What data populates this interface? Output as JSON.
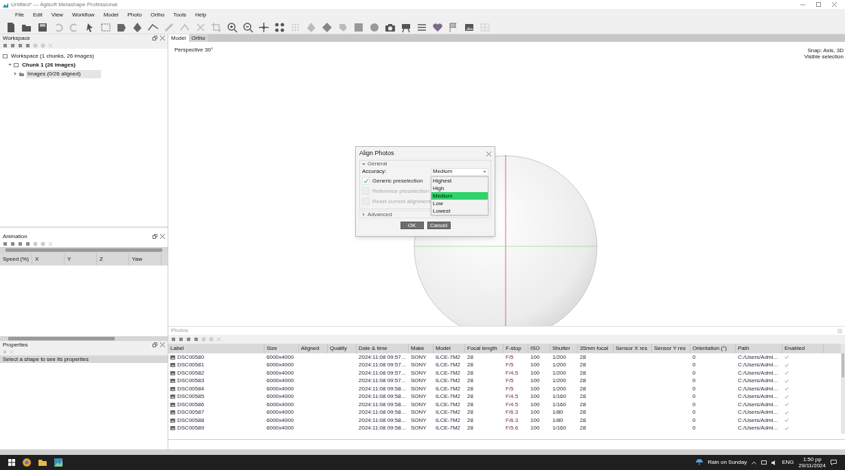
{
  "window": {
    "title": "Untitled* — Agisoft Metashape Professional"
  },
  "menu": [
    "File",
    "Edit",
    "View",
    "Workflow",
    "Model",
    "Photo",
    "Ortho",
    "Tools",
    "Help"
  ],
  "workspace": {
    "title": "Workspace",
    "tree": [
      {
        "label": "Workspace (1 chunks, 26 images)",
        "selected": false,
        "children": [
          {
            "label": "Chunk 1 (26 images)",
            "expanded": true,
            "selected": false,
            "children": [
              {
                "label": "Images (0/26 aligned)",
                "expanded": false,
                "selected": true
              }
            ]
          }
        ]
      }
    ]
  },
  "animation": {
    "title": "Animation",
    "columns": [
      "Speed (%)",
      "X",
      "Y",
      "Z",
      "Yaw"
    ]
  },
  "properties": {
    "title": "Properties",
    "hint": "Select a shape to see its properties"
  },
  "view_tabs": [
    {
      "label": "Model",
      "selected": true
    },
    {
      "label": "Ortho",
      "selected": false
    }
  ],
  "viewport": {
    "projection": "Perspective 30°",
    "snap": "Snap: Axis, 3D",
    "selection_mode": "Visible selection"
  },
  "dialog": {
    "title": "Align Photos",
    "section": "General",
    "accuracy_label": "Accuracy:",
    "accuracy_value": "Medium",
    "options": [
      {
        "label": "Highest",
        "selected": false
      },
      {
        "label": "High",
        "selected": false
      },
      {
        "label": "Medium",
        "selected": true
      },
      {
        "label": "Low",
        "selected": false
      },
      {
        "label": "Lowest",
        "selected": false
      }
    ],
    "checkboxes": [
      {
        "label": "Generic preselection",
        "checked": true,
        "disabled": false
      },
      {
        "label": "Reference preselection",
        "checked": false,
        "disabled": true
      },
      {
        "label": "Reset current alignment",
        "checked": false,
        "disabled": true
      }
    ],
    "advanced": "Advanced",
    "buttons": [
      "OK",
      "Cancel"
    ]
  },
  "photos": {
    "title": "Photos",
    "columns": [
      "Label",
      "Size",
      "Aligned",
      "Quality",
      "Date & time",
      "Make",
      "Model",
      "Focal length",
      "F-stop",
      "ISO",
      "Shutter",
      "35mm focal",
      "Sensor X res",
      "Sensor Y res",
      "Orientation (°)",
      "Path",
      "Enabled"
    ],
    "rows": [
      {
        "cells": [
          "DSC00580",
          "6000x4000",
          "",
          "",
          "2024:11:08 09:57...",
          "SONY",
          "ILCE-7M2",
          "28",
          "F/5",
          "100",
          "1/200",
          "28",
          "",
          "",
          "0",
          "C:/Users/Admi..."
        ],
        "enabled": true
      },
      {
        "cells": [
          "DSC00581",
          "6000x4000",
          "",
          "",
          "2024:11:08 09:57...",
          "SONY",
          "ILCE-7M2",
          "28",
          "F/5",
          "100",
          "1/200",
          "28",
          "",
          "",
          "0",
          "C:/Users/Admi..."
        ],
        "enabled": true
      },
      {
        "cells": [
          "DSC00582",
          "6000x4000",
          "",
          "",
          "2024:11:08 09:57...",
          "SONY",
          "ILCE-7M2",
          "28",
          "F/4.5",
          "100",
          "1/200",
          "28",
          "",
          "",
          "0",
          "C:/Users/Admi..."
        ],
        "enabled": true
      },
      {
        "cells": [
          "DSC00583",
          "6000x4000",
          "",
          "",
          "2024:11:08 09:57...",
          "SONY",
          "ILCE-7M2",
          "28",
          "F/5",
          "100",
          "1/200",
          "28",
          "",
          "",
          "0",
          "C:/Users/Admi..."
        ],
        "enabled": true
      },
      {
        "cells": [
          "DSC00584",
          "6000x4000",
          "",
          "",
          "2024:11:08 09:58...",
          "SONY",
          "ILCE-7M2",
          "28",
          "F/5",
          "100",
          "1/200",
          "28",
          "",
          "",
          "0",
          "C:/Users/Admi..."
        ],
        "enabled": true
      },
      {
        "cells": [
          "DSC00585",
          "6000x4000",
          "",
          "",
          "2024:11:08 09:58...",
          "SONY",
          "ILCE-7M2",
          "28",
          "F/4.5",
          "100",
          "1/160",
          "28",
          "",
          "",
          "0",
          "C:/Users/Admi..."
        ],
        "enabled": true
      },
      {
        "cells": [
          "DSC00586",
          "6000x4000",
          "",
          "",
          "2024:11:08 09:58...",
          "SONY",
          "ILCE-7M2",
          "28",
          "F/4.5",
          "100",
          "1/160",
          "28",
          "",
          "",
          "0",
          "C:/Users/Admi..."
        ],
        "enabled": true
      },
      {
        "cells": [
          "DSC00587",
          "6000x4000",
          "",
          "",
          "2024:11:08 09:58...",
          "SONY",
          "ILCE-7M2",
          "28",
          "F/6.3",
          "100",
          "1/80",
          "28",
          "",
          "",
          "0",
          "C:/Users/Admi..."
        ],
        "enabled": true
      },
      {
        "cells": [
          "DSC00588",
          "6000x4000",
          "",
          "",
          "2024:11:08 09:58...",
          "SONY",
          "ILCE-7M2",
          "28",
          "F/6.3",
          "100",
          "1/80",
          "28",
          "",
          "",
          "0",
          "C:/Users/Admi..."
        ],
        "enabled": true
      },
      {
        "cells": [
          "DSC00589",
          "6000x4000",
          "",
          "",
          "2024:11:08 09:58...",
          "SONY",
          "ILCE-7M2",
          "28",
          "F/5.6",
          "100",
          "1/160",
          "28",
          "",
          "",
          "0",
          "C:/Users/Admi..."
        ],
        "enabled": true
      }
    ]
  },
  "taskbar": {
    "weather": "Rain on Sunday",
    "language": "ENG",
    "time": "1:50 pp",
    "date": "29/11/2024"
  }
}
